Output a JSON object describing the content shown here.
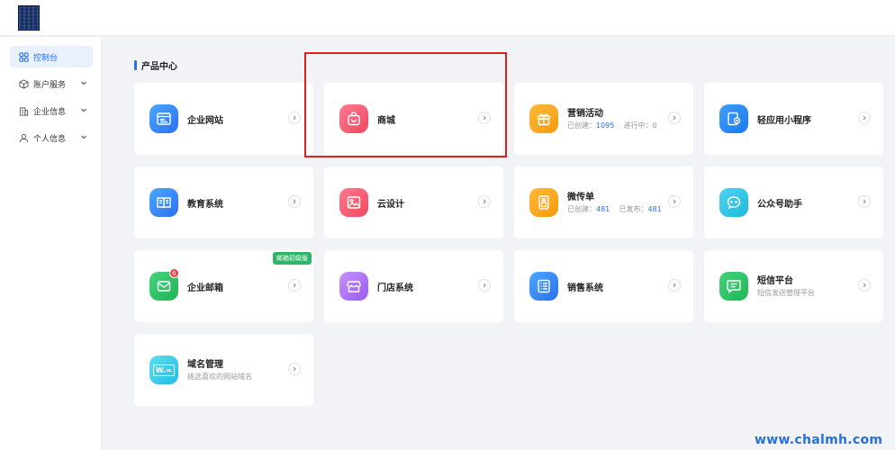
{
  "sidebar": {
    "items": [
      {
        "label": "控制台"
      },
      {
        "label": "账户服务"
      },
      {
        "label": "企业信息"
      },
      {
        "label": "个人信息"
      }
    ]
  },
  "section": {
    "title": "产品中心"
  },
  "cards": {
    "website": {
      "name": "企业网站"
    },
    "mall": {
      "name": "商城"
    },
    "marketing": {
      "name": "营销活动",
      "stat1_label": "已创建：",
      "stat1_value": "1095",
      "stat2_label": "进行中：",
      "stat2_value": "0"
    },
    "miniapp": {
      "name": "轻应用小程序"
    },
    "education": {
      "name": "教育系统"
    },
    "clouddesign": {
      "name": "云设计"
    },
    "flyer": {
      "name": "微传单",
      "stat1_label": "已创建：",
      "stat1_value": "481",
      "stat2_label": "已发布：",
      "stat2_value": "481"
    },
    "wechat": {
      "name": "公众号助手"
    },
    "email": {
      "name": "企业邮箱",
      "badge": "6",
      "ribbon": "邮箱初级版"
    },
    "store": {
      "name": "门店系统"
    },
    "sales": {
      "name": "销售系统"
    },
    "sms": {
      "name": "短信平台",
      "desc": "短信发送管理平台"
    },
    "domain": {
      "name": "域名管理",
      "desc": "挑选喜欢的网站域名",
      "icon_text": "W.="
    }
  },
  "watermark": "www.chalmh.com",
  "colors": {
    "accent": "#2d6ff0",
    "highlight": "#e02020"
  }
}
